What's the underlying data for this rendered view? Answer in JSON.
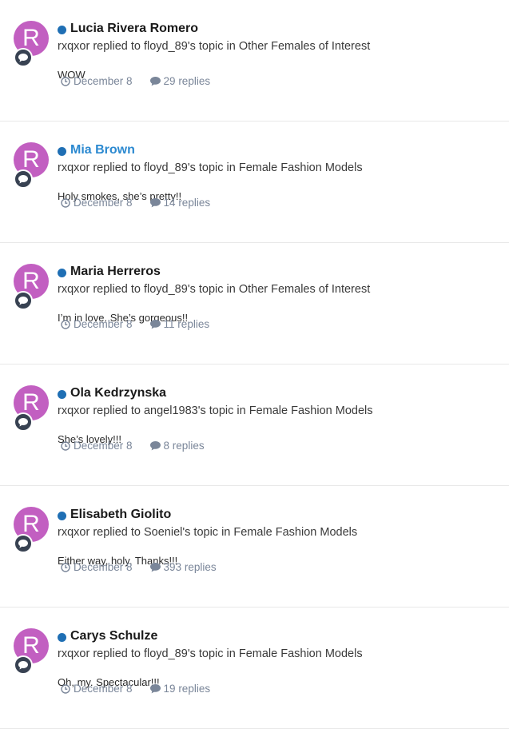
{
  "avatar_letter": "R",
  "colors": {
    "avatar": "#c25fc1",
    "status_dot": "#1f6fb4",
    "link": "#2b89d0",
    "badge": "#384252",
    "meta": "#7a8699"
  },
  "items": [
    {
      "title": "Lucia Rivera Romero",
      "action": "rxqxor replied to floyd_89's topic in Other Females of Interest",
      "snippet": "WOW",
      "date": "December 8",
      "replies": "29 replies"
    },
    {
      "title": "Mia Brown",
      "action": "rxqxor replied to floyd_89's topic in Female Fashion Models",
      "snippet": "Holy smokes, she’s pretty!!",
      "date": "December 8",
      "replies": "14 replies"
    },
    {
      "title": "Maria Herreros",
      "action": "rxqxor replied to floyd_89's topic in Other Females of Interest",
      "snippet": "I’m in love. She’s gorgeous!!",
      "date": "December 8",
      "replies": "11 replies"
    },
    {
      "title": "Ola Kedrzynska",
      "action": "rxqxor replied to angel1983's topic in Female Fashion Models",
      "snippet": "She’s lovely!!!",
      "date": "December 8",
      "replies": "8 replies"
    },
    {
      "title": "Elisabeth Giolito",
      "action": "rxqxor replied to Soeniel's topic in Female Fashion Models",
      "snippet": "Either way, holy. Thanks!!!",
      "date": "December 8",
      "replies": "393 replies"
    },
    {
      "title": "Carys Schulze",
      "action": "rxqxor replied to floyd_89's topic in Female Fashion Models",
      "snippet": "Oh, my. Spectacular!!!",
      "date": "December 8",
      "replies": "19 replies"
    }
  ]
}
